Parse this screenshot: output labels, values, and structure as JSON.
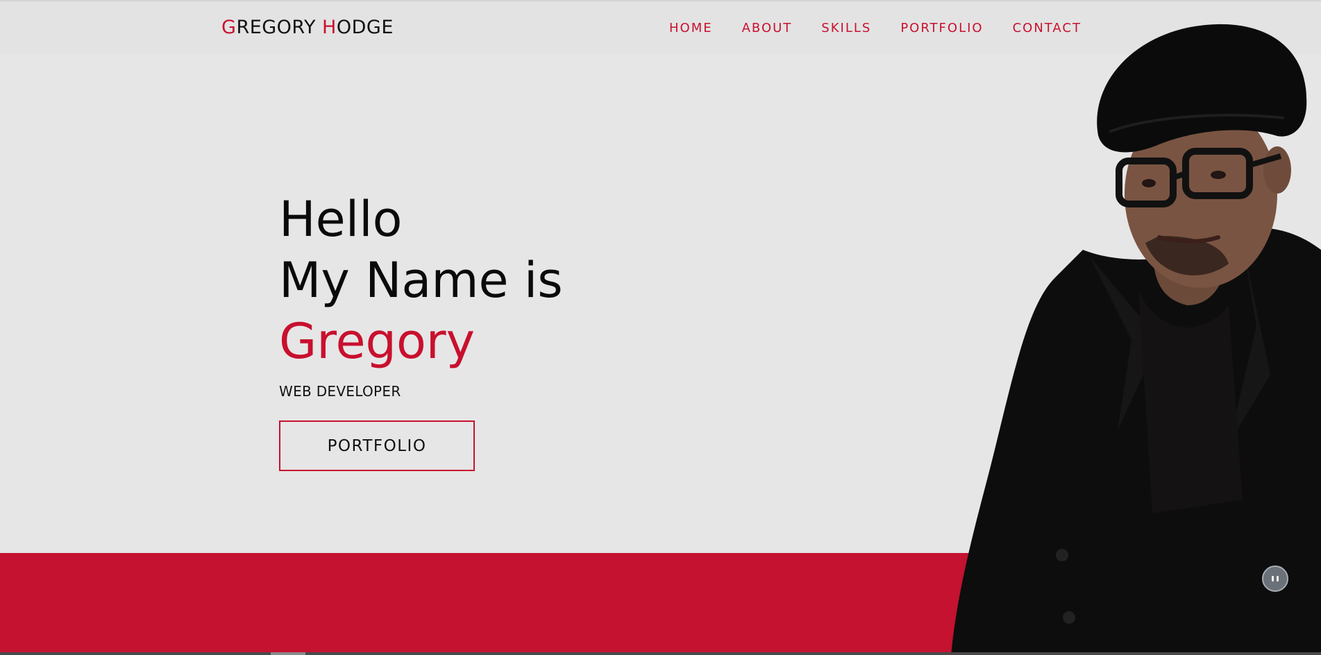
{
  "header": {
    "logo": {
      "first_initial": "G",
      "first_rest": "REGORY ",
      "last_initial": "H",
      "last_rest": "ODGE"
    },
    "nav": [
      {
        "label": "HOME"
      },
      {
        "label": "ABOUT"
      },
      {
        "label": "SKILLS"
      },
      {
        "label": "PORTFOLIO"
      },
      {
        "label": "CONTACT"
      }
    ]
  },
  "hero": {
    "line1": "Hello",
    "line2": "My Name is",
    "name": "Gregory",
    "subtitle": "WEB DEVELOPER",
    "cta_label": "PORTFOLIO"
  },
  "colors": {
    "accent": "#c8102e",
    "background": "#e6e6e6",
    "band": "#c41230"
  },
  "icons": {
    "chat": "chat-bubble-icon"
  }
}
